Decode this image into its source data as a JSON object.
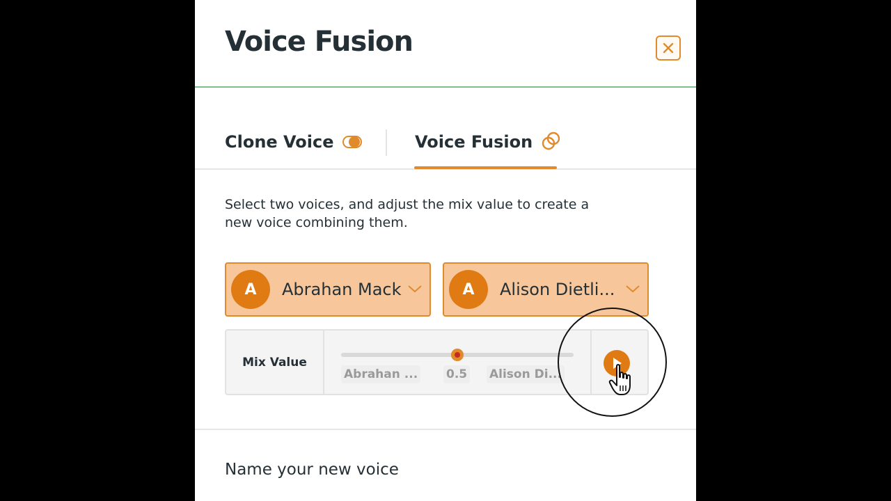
{
  "header": {
    "title": "Voice Fusion",
    "close_icon": "close-icon"
  },
  "tabs": [
    {
      "label": "Clone Voice",
      "icon": "clone-toggle-icon",
      "active": false
    },
    {
      "label": "Voice Fusion",
      "icon": "fusion-circles-icon",
      "active": true
    }
  ],
  "description": "Select two voices, and adjust the mix value to create a new voice combining them.",
  "voices": [
    {
      "avatar_initial": "A",
      "name": "Abrahan Mack"
    },
    {
      "avatar_initial": "A",
      "name": "Alison Dietli..."
    }
  ],
  "mix": {
    "label": "Mix Value",
    "left_voice": "Abrahan ...",
    "value_text": "0.5",
    "value": 0.5,
    "right_voice": "Alison Di..."
  },
  "name_section": {
    "label": "Name your new voice"
  },
  "colors": {
    "accent": "#e08a2c",
    "accent_fill": "#f7c79b",
    "avatar": "#e07b14",
    "text": "#243036",
    "header_border": "#7cc08a"
  }
}
